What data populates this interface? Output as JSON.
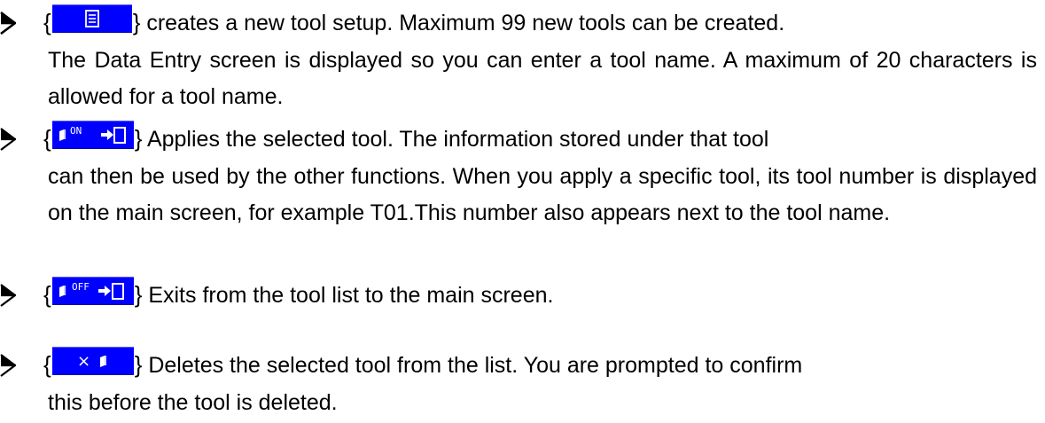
{
  "list": {
    "bullet_icon": "arrowhead-bullet-icon",
    "items": [
      {
        "button": {
          "icon": "new-document-icon",
          "color": "#0000ff"
        },
        "open_brace": "{",
        "close_brace": "}",
        "line1": "creates a new tool setup. Maximum 99 new tools can be created.",
        "rest": "The Data Entry screen is displayed so you can enter a tool name. A maximum of 20 characters is allowed for a tool name."
      },
      {
        "button": {
          "icon": "apply-tool-on-icon",
          "label": "ON",
          "color": "#0000ff"
        },
        "open_brace": "{",
        "close_brace": "}",
        "line1": "Applies the selected tool. The information stored under that tool",
        "rest": "can then be used by the other functions. When you apply a specific tool, its tool number is displayed on the main screen, for example T01.This number also appears next to the tool name."
      },
      {
        "button": {
          "icon": "exit-tool-off-icon",
          "label": "OFF",
          "color": "#0000ff"
        },
        "open_brace": "{",
        "close_brace": "}",
        "line1": "Exits from the tool list to the main screen.",
        "rest": ""
      },
      {
        "button": {
          "icon": "delete-tool-icon",
          "label": "×",
          "color": "#0000ff"
        },
        "open_brace": "{",
        "close_brace": "}",
        "line1": "Deletes the selected tool from the list. You are prompted to confirm",
        "rest": "this before the tool is deleted."
      }
    ]
  }
}
